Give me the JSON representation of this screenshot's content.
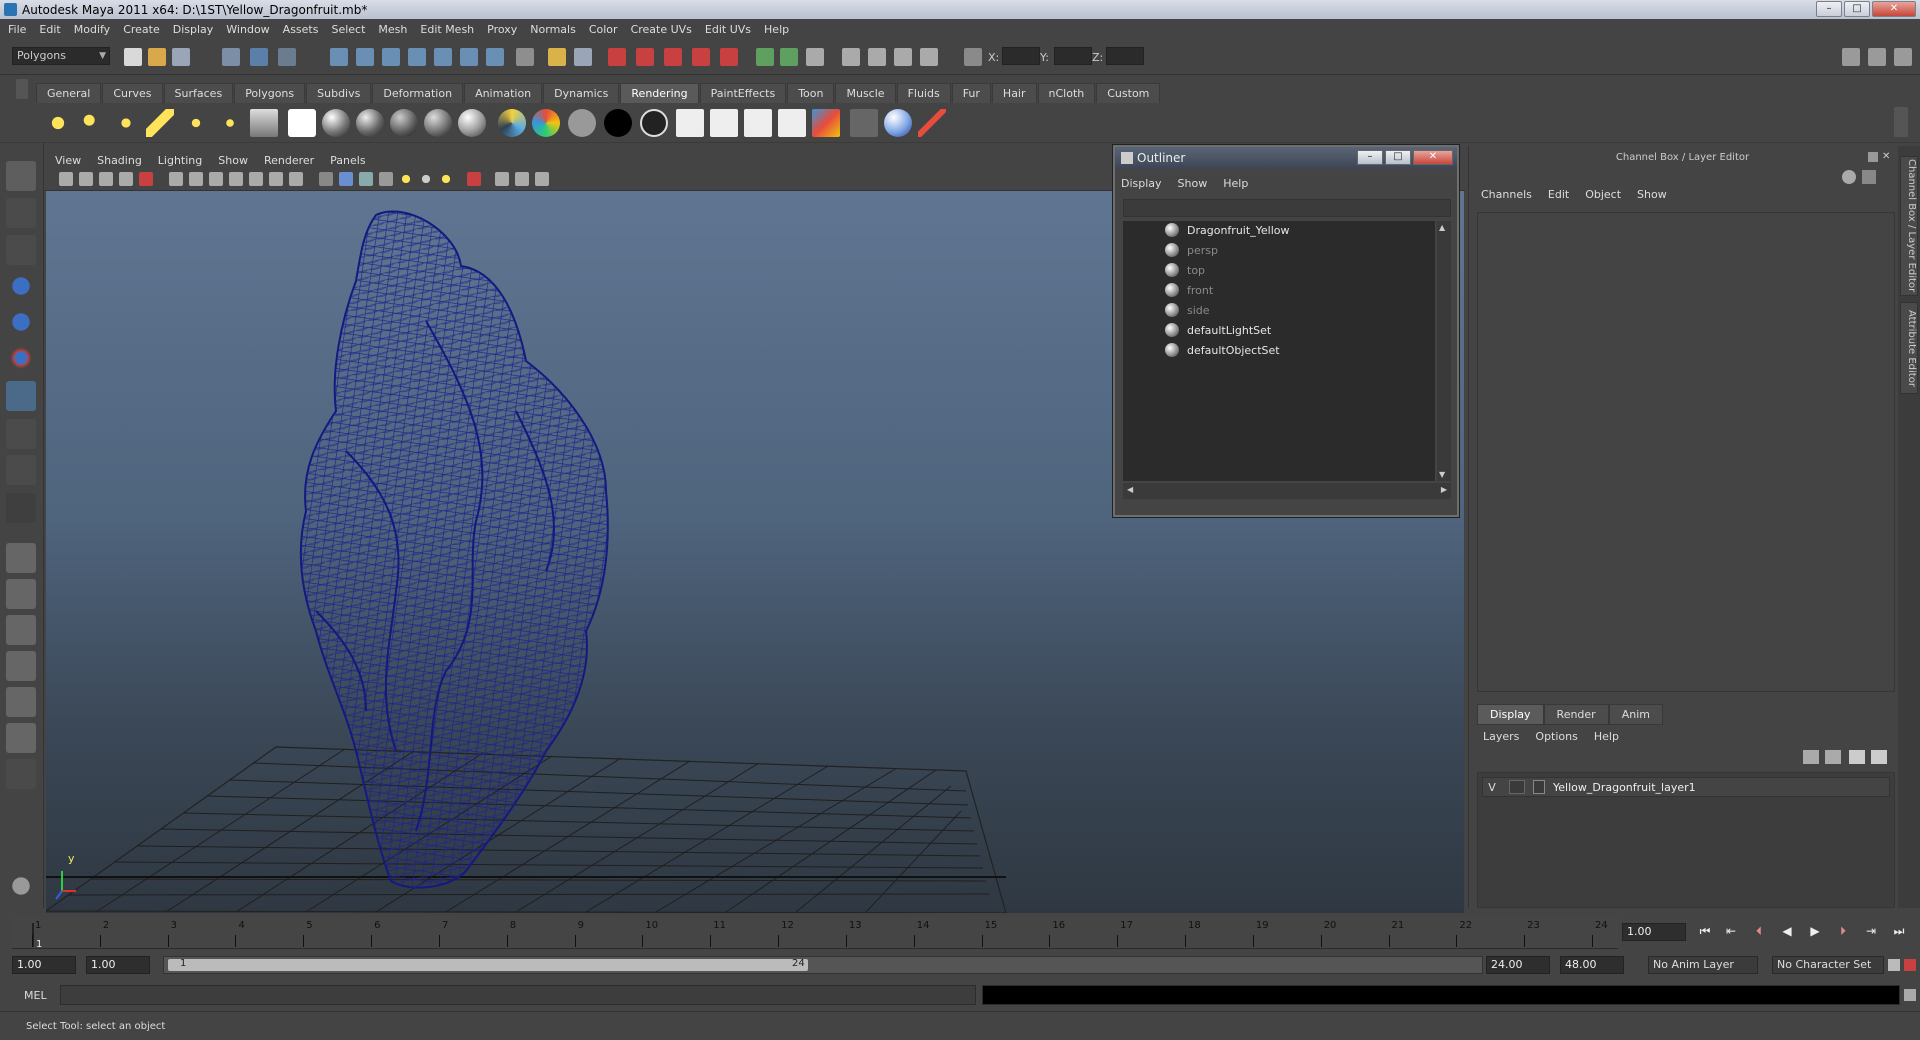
{
  "window": {
    "title": "Autodesk Maya 2011 x64: D:\\1ST\\Yellow_Dragonfruit.mb*"
  },
  "menubar": [
    "File",
    "Edit",
    "Modify",
    "Create",
    "Display",
    "Window",
    "Assets",
    "Select",
    "Mesh",
    "Edit Mesh",
    "Proxy",
    "Normals",
    "Color",
    "Create UVs",
    "Edit UVs",
    "Help"
  ],
  "status_line": {
    "mode": "Polygons",
    "x_label": "X:",
    "y_label": "Y:",
    "z_label": "Z:"
  },
  "shelf_tabs": [
    "General",
    "Curves",
    "Surfaces",
    "Polygons",
    "Subdivs",
    "Deformation",
    "Animation",
    "Dynamics",
    "Rendering",
    "PaintEffects",
    "Toon",
    "Muscle",
    "Fluids",
    "Fur",
    "Hair",
    "nCloth",
    "Custom"
  ],
  "active_shelf_tab": "Rendering",
  "viewport": {
    "menu": [
      "View",
      "Shading",
      "Lighting",
      "Show",
      "Renderer",
      "Panels"
    ],
    "mesh_color": "#1a1f8c",
    "axis_y": "y"
  },
  "outliner": {
    "title": "Outliner",
    "menu": [
      "Display",
      "Show",
      "Help"
    ],
    "items": [
      {
        "label": "Dragonfruit_Yellow",
        "dim": false,
        "icon": "transform-icon"
      },
      {
        "label": "persp",
        "dim": true,
        "icon": "camera-icon"
      },
      {
        "label": "top",
        "dim": true,
        "icon": "camera-icon"
      },
      {
        "label": "front",
        "dim": true,
        "icon": "camera-icon"
      },
      {
        "label": "side",
        "dim": true,
        "icon": "camera-icon"
      },
      {
        "label": "defaultLightSet",
        "dim": false,
        "icon": "set-icon"
      },
      {
        "label": "defaultObjectSet",
        "dim": false,
        "icon": "set-icon"
      }
    ]
  },
  "channel_box": {
    "title": "Channel Box / Layer Editor",
    "menu": [
      "Channels",
      "Edit",
      "Object",
      "Show"
    ],
    "layer_tabs": [
      "Display",
      "Render",
      "Anim"
    ],
    "layer_menu": [
      "Layers",
      "Options",
      "Help"
    ],
    "layer": {
      "visible": "V",
      "name": "Yellow_Dragonfruit_layer1"
    },
    "side_tabs": [
      "Channel Box / Layer Editor",
      "Attribute Editor"
    ]
  },
  "time_slider": {
    "ticks": [
      "1",
      "2",
      "3",
      "4",
      "5",
      "6",
      "7",
      "8",
      "9",
      "10",
      "11",
      "12",
      "13",
      "14",
      "15",
      "16",
      "17",
      "18",
      "19",
      "20",
      "21",
      "22",
      "23",
      "24"
    ],
    "current_frame_label": "1",
    "current_time": "1.00"
  },
  "range_slider": {
    "start_time": "1.00",
    "playback_start": "1.00",
    "range_start_label": "1",
    "range_end_label": "24",
    "playback_end": "24.00",
    "end_time": "48.00",
    "anim_layer": "No Anim Layer",
    "character_set": "No Character Set"
  },
  "command_line": {
    "label": "MEL"
  },
  "help_line": {
    "text": "Select Tool: select an object"
  }
}
